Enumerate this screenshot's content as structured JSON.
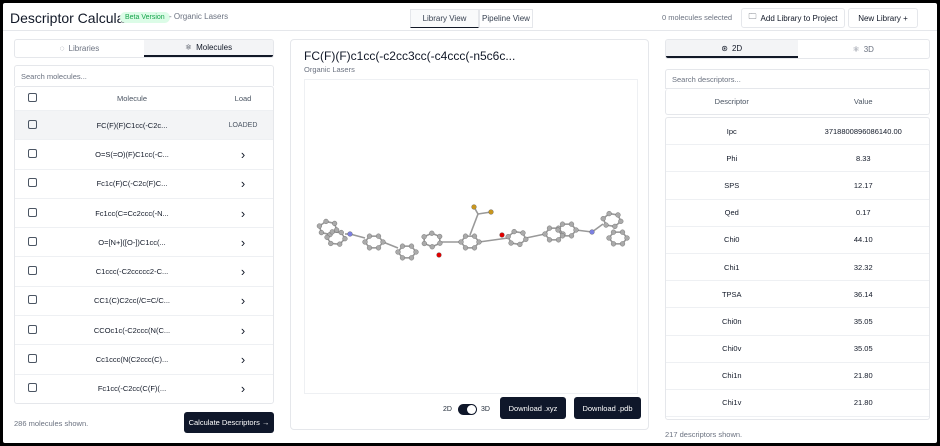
{
  "header": {
    "title": "Descriptor Calculation",
    "badge": "Beta Version",
    "project": "- Organic Lasers",
    "view_tabs": [
      "Library View",
      "Pipeline View"
    ],
    "selected_count": "0 molecules selected",
    "add_library": "Add Library to Project",
    "new_library": "New Library +"
  },
  "left": {
    "tabs": [
      "Libraries",
      "Molecules"
    ],
    "search_placeholder": "Search molecules...",
    "columns": [
      "Molecule",
      "Load"
    ],
    "rows": [
      {
        "smiles": "FC(F)(F)C1cc(-C2c...",
        "load": "LOADED"
      },
      {
        "smiles": "O=S(=O)(F)C1cc(-C...",
        "load": "›"
      },
      {
        "smiles": "Fc1c(F)C(-C2c(F)C...",
        "load": "›"
      },
      {
        "smiles": "Fc1cc(C=Cc2ccc(-N...",
        "load": "›"
      },
      {
        "smiles": "O=[N+]([O-])C1cc(...",
        "load": "›"
      },
      {
        "smiles": "C1ccc(-C2ccccc2-C...",
        "load": "›"
      },
      {
        "smiles": "CC1(C)C2cc(/C=C/C...",
        "load": "›"
      },
      {
        "smiles": "CCOc1c(-C2ccc(N(C...",
        "load": "›"
      },
      {
        "smiles": "Cc1ccc(N(C2ccc(C)...",
        "load": "›"
      },
      {
        "smiles": "Fc1cc(-C2cc(C(F)(...",
        "load": "›"
      }
    ],
    "footer": "286 molecules shown.",
    "calculate": "Calculate Descriptors →"
  },
  "center": {
    "title": "FC(F)(F)c1cc(-c2cc3cc(-c4ccc(-n5c6c...",
    "subtitle": "Organic Lasers",
    "toggle_left": "2D",
    "toggle_right": "3D",
    "toggle_state": "3D",
    "download_xyz": "Download .xyz",
    "download_pdb": "Download .pdb"
  },
  "right": {
    "tabs": [
      "2D",
      "3D"
    ],
    "search_placeholder": "Search descriptors...",
    "columns": [
      "Descriptor",
      "Value"
    ],
    "rows": [
      {
        "name": "Ipc",
        "value": "3718800896086140.00"
      },
      {
        "name": "Phi",
        "value": "8.33"
      },
      {
        "name": "SPS",
        "value": "12.17"
      },
      {
        "name": "Qed",
        "value": "0.17"
      },
      {
        "name": "Chi0",
        "value": "44.10"
      },
      {
        "name": "Chi1",
        "value": "32.32"
      },
      {
        "name": "TPSA",
        "value": "36.14"
      },
      {
        "name": "Chi0n",
        "value": "35.05"
      },
      {
        "name": "Chi0v",
        "value": "35.05"
      },
      {
        "name": "Chi1n",
        "value": "21.80"
      },
      {
        "name": "Chi1v",
        "value": "21.80"
      }
    ],
    "footer": "217 descriptors shown."
  },
  "colors": {
    "accent": "#0f172a",
    "badge": "#16a34a",
    "nitrogen": "#7b7fe0",
    "oxygen": "#e00000",
    "fluorine": "#c8961e"
  }
}
